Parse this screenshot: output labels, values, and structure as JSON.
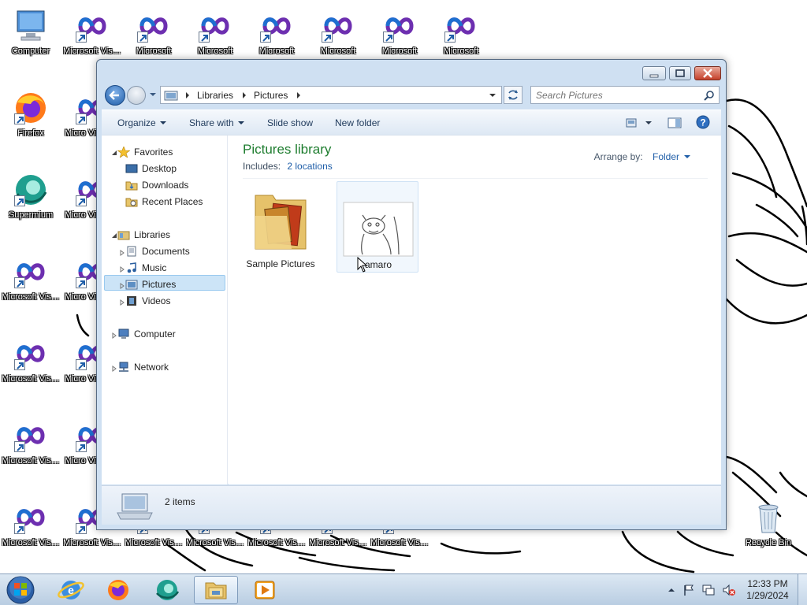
{
  "desktop": {
    "icons": [
      {
        "label": "Computer",
        "kind": "computer"
      },
      {
        "label": "Firefox",
        "kind": "firefox"
      },
      {
        "label": "Supermium",
        "kind": "supermium"
      },
      {
        "label": "Microsoft Visual Stud...",
        "kind": "vs"
      },
      {
        "label": "Microsoft Visual Stud...",
        "kind": "vs"
      },
      {
        "label": "Microsoft Visual Stud...",
        "kind": "vs"
      },
      {
        "label": "Microsoft Visual Stud...",
        "kind": "vs"
      },
      {
        "label": "Microsoft Visual S",
        "kind": "vs"
      },
      {
        "label": "Micro Visual S",
        "kind": "vs"
      },
      {
        "label": "Micro Visual S",
        "kind": "vs"
      },
      {
        "label": "Micro Visual S",
        "kind": "vs"
      },
      {
        "label": "Micro Visual S",
        "kind": "vs"
      },
      {
        "label": "Micro Visual S",
        "kind": "vs"
      },
      {
        "label": "Microsoft Visual Stud...",
        "kind": "vs"
      },
      {
        "label": "Microsoft",
        "kind": "vs"
      },
      {
        "label": "Microsoft",
        "kind": "vs"
      },
      {
        "label": "Microsoft",
        "kind": "vs"
      },
      {
        "label": "Microsoft",
        "kind": "vs"
      },
      {
        "label": "Microsoft",
        "kind": "vs"
      },
      {
        "label": "Microsoft",
        "kind": "vs"
      },
      {
        "label": "Microsoft Visual Stud2",
        "kind": "vs"
      },
      {
        "label": "Microsoft Visual Stud...",
        "kind": "vs"
      },
      {
        "label": "Microsoft Visual Stud...",
        "kind": "vs"
      },
      {
        "label": "Microsoft Visual Stud...",
        "kind": "vs"
      },
      {
        "label": "Microsoft Visual Stud...",
        "kind": "vs"
      },
      {
        "label": "Recycle Bin",
        "kind": "recycle"
      }
    ]
  },
  "window": {
    "address": {
      "crumbs": [
        "Libraries",
        "Pictures"
      ]
    },
    "search": {
      "placeholder": "Search Pictures"
    },
    "commandbar": {
      "organize": "Organize",
      "share_with": "Share with",
      "slide_show": "Slide show",
      "new_folder": "New folder"
    },
    "nav": {
      "favorites": "Favorites",
      "desktop": "Desktop",
      "downloads": "Downloads",
      "recent_places": "Recent Places",
      "libraries": "Libraries",
      "documents": "Documents",
      "music": "Music",
      "pictures": "Pictures",
      "videos": "Videos",
      "computer": "Computer",
      "network": "Network"
    },
    "library": {
      "title": "Pictures library",
      "includes_label": "Includes:",
      "includes_link": "2 locations",
      "arrange_label": "Arrange by:",
      "arrange_value": "Folder"
    },
    "items": [
      {
        "name": "Sample Pictures",
        "kind": "folder"
      },
      {
        "name": "amaro",
        "kind": "image"
      }
    ],
    "details": {
      "count": "2 items"
    }
  },
  "taskbar": {
    "clock_time": "12:33 PM",
    "clock_date": "1/29/2024"
  }
}
